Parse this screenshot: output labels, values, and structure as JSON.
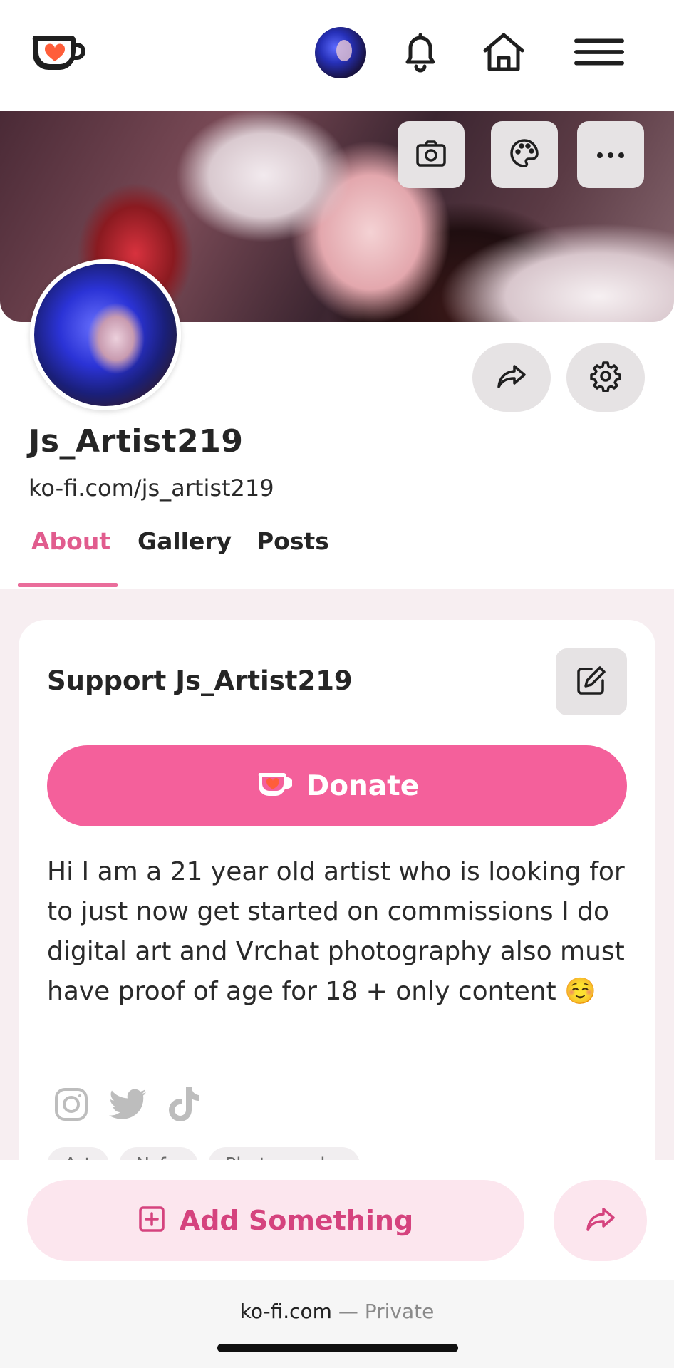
{
  "header": {
    "logo_icon": "kofi-cup-logo",
    "icons": [
      "bell-icon",
      "home-icon",
      "menu-icon"
    ]
  },
  "banner": {
    "buttons": [
      "camera-icon",
      "palette-icon",
      "more-icon"
    ]
  },
  "profile": {
    "username": "Js_Artist219",
    "url": "ko-fi.com/js_artist219"
  },
  "tabs": [
    {
      "label": "About",
      "active": true
    },
    {
      "label": "Gallery",
      "active": false
    },
    {
      "label": "Posts",
      "active": false
    }
  ],
  "support": {
    "title": "Support Js_Artist219",
    "donate_label": "Donate",
    "bio": "Hi I am a 21 year old artist who is looking for to just now get started on commissions I do digital art and Vrchat photography also must have proof of age for 18 + only content ☺️",
    "socials": [
      "instagram-icon",
      "twitter-icon",
      "tiktok-icon"
    ],
    "tags": [
      "Art",
      "Nsfw",
      "Photography"
    ]
  },
  "bottom_bar": {
    "add_label": "Add Something"
  },
  "browser": {
    "domain": "ko-fi.com",
    "separator": "—",
    "mode": "Private"
  },
  "colors": {
    "accent": "#F4609B",
    "accent_soft": "#FCE6EE",
    "kofi_orange": "#FF5E3A",
    "tab_active": "#E15C8E"
  }
}
